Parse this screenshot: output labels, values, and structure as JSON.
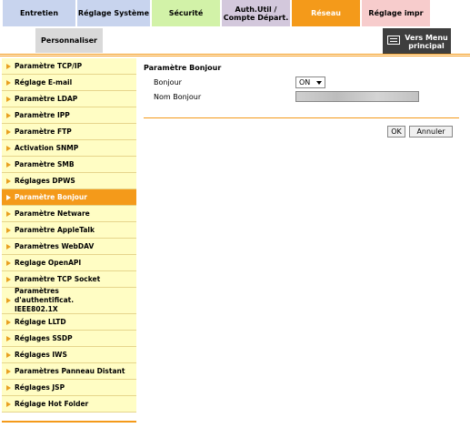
{
  "tabs": {
    "entretien": "Entretien",
    "reglage_systeme": "Réglage Système",
    "securite": "Sécurité",
    "auth": "Auth.Util / Compte Départ.",
    "reseau": "Réseau",
    "reglage_impr": "Réglage impr"
  },
  "subtab": {
    "personnaliser": "Personnaliser"
  },
  "menu_button": {
    "label": "Vers Menu principal"
  },
  "sidebar": {
    "items": [
      {
        "label": "Paramètre TCP/IP"
      },
      {
        "label": "Réglage E-mail"
      },
      {
        "label": "Paramètre LDAP"
      },
      {
        "label": "Paramètre IPP"
      },
      {
        "label": "Paramètre FTP"
      },
      {
        "label": "Activation SNMP"
      },
      {
        "label": "Paramètre SMB"
      },
      {
        "label": "Réglages DPWS"
      },
      {
        "label": "Paramètre Bonjour"
      },
      {
        "label": "Paramètre Netware"
      },
      {
        "label": "Paramètre AppleTalk"
      },
      {
        "label": "Paramètres WebDAV"
      },
      {
        "label": "Reglage OpenAPI"
      },
      {
        "label": "Paramètre TCP Socket"
      },
      {
        "label": "Paramètres d'authentificat. IEEE802.1X"
      },
      {
        "label": "Réglage LLTD"
      },
      {
        "label": "Réglages SSDP"
      },
      {
        "label": "Réglages IWS"
      },
      {
        "label": "Paramètres Panneau Distant"
      },
      {
        "label": "Réglages JSP"
      },
      {
        "label": "Réglage Hot Folder"
      }
    ]
  },
  "content": {
    "title": "Paramètre Bonjour",
    "bonjour_label": "Bonjour",
    "bonjour_value": "ON",
    "nom_label": "Nom Bonjour",
    "ok": "OK",
    "annuler": "Annuler"
  },
  "colors": {
    "accent": "#f49a1a",
    "sidebar_bg": "#fffdc4"
  }
}
